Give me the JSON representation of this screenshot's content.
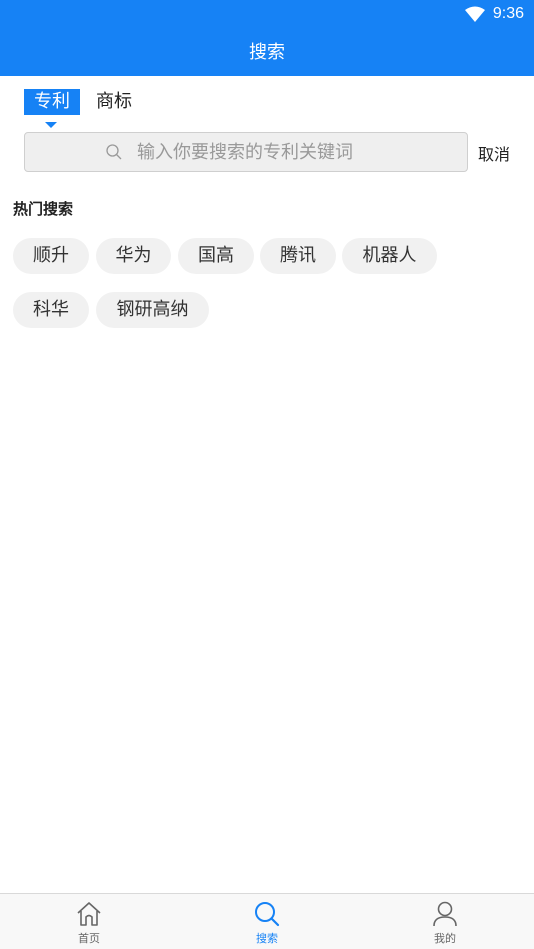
{
  "status_bar": {
    "time": "9:36",
    "icon": "wifi-icon"
  },
  "header": {
    "title": "搜索"
  },
  "tabs": [
    {
      "label": "专利",
      "active": true
    },
    {
      "label": "商标",
      "active": false
    }
  ],
  "search": {
    "placeholder": "输入你要搜索的专利关键词",
    "value": "",
    "cancel_label": "取消",
    "icon": "search-icon"
  },
  "hot_search": {
    "title": "热门搜索",
    "tags": [
      "顺升",
      "华为",
      "国高",
      "腾讯",
      "机器人",
      "科华",
      "钢研高纳"
    ]
  },
  "bottom_nav": [
    {
      "label": "首页",
      "icon": "home-icon",
      "active": false
    },
    {
      "label": "搜索",
      "icon": "search-icon",
      "active": true
    },
    {
      "label": "我的",
      "icon": "user-icon",
      "active": false
    }
  ],
  "colors": {
    "accent": "#1682f5",
    "tag_bg": "#f1f1f1",
    "background": "#ffffff"
  }
}
